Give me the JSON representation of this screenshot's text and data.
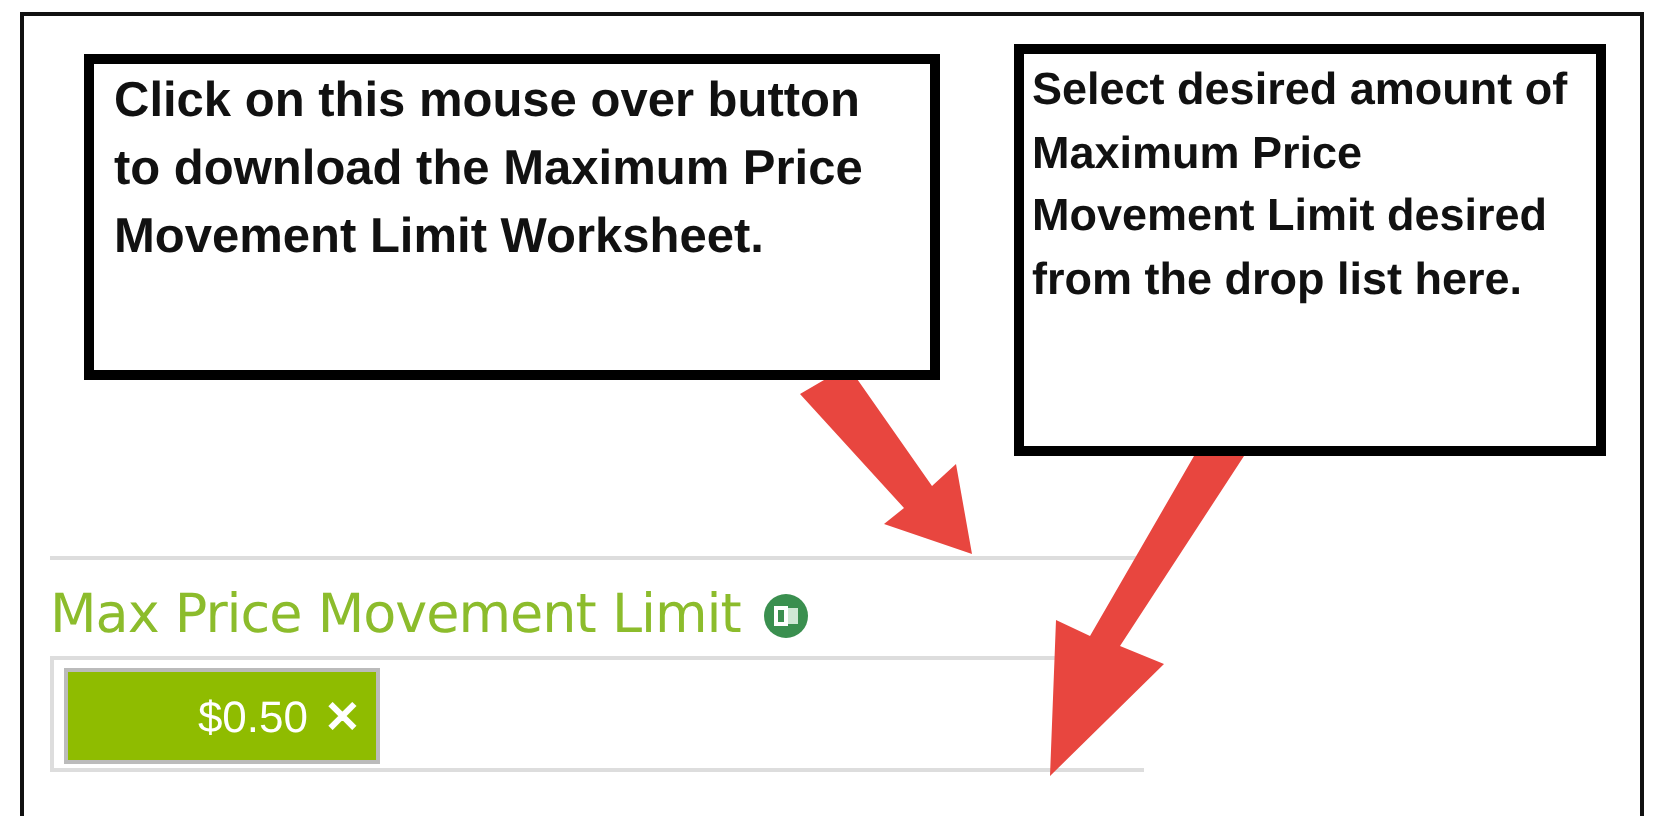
{
  "callouts": [
    {
      "text": "Click on this mouse over button to download the Maximum Price Movement Limit Worksheet."
    },
    {
      "text": "Select desired amount of Maximum Price Movement Limit desired from the drop list here."
    }
  ],
  "section": {
    "title": "Max Price Movement Limit"
  },
  "selection": {
    "tags": [
      {
        "label": "$0.50",
        "remove": "✕"
      }
    ]
  }
}
